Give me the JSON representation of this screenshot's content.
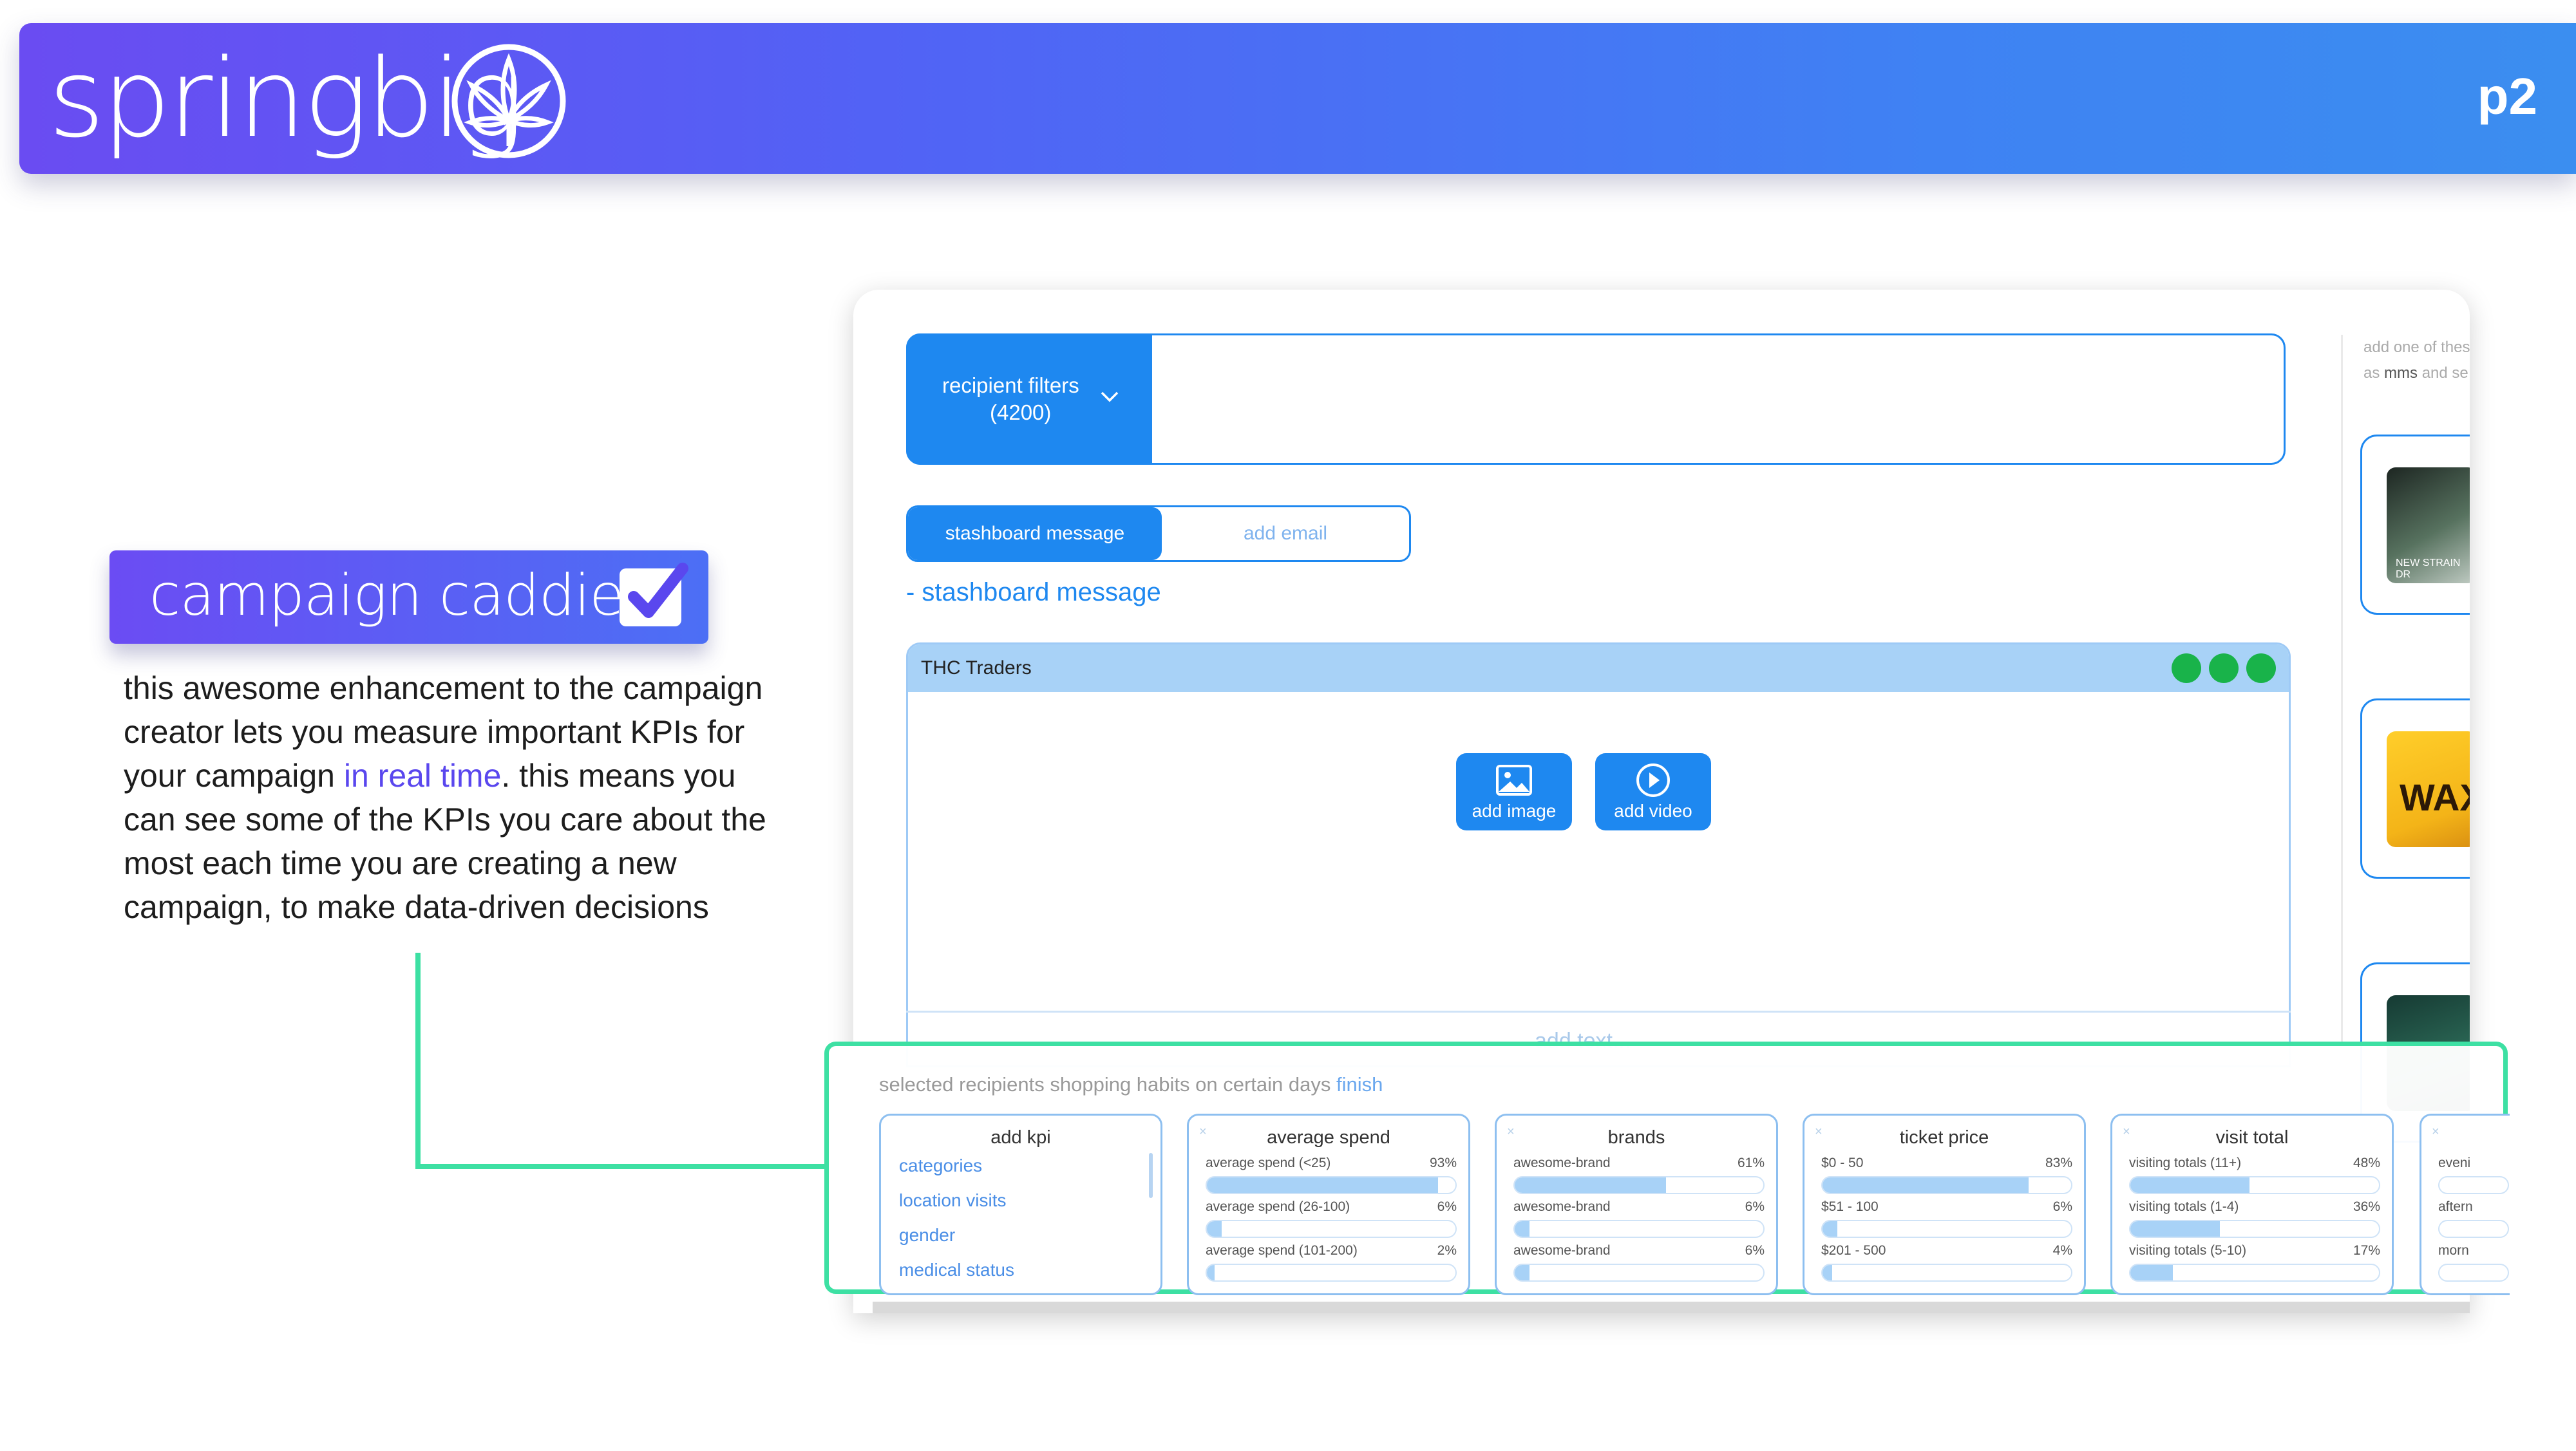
{
  "banner": {
    "brand": "springbig",
    "page": "p2"
  },
  "caddie": {
    "title": "campaign caddie",
    "desc_before": "this awesome enhancement to the campaign creator lets you measure important KPIs for your campaign ",
    "desc_highlight": "in real time",
    "desc_after": ". this means you can see some of the KPIs you care about the most each time you are creating a new campaign, to make data-driven decisions"
  },
  "app": {
    "filters": {
      "label": "recipient filters",
      "count": "(4200)"
    },
    "tabs": {
      "active": "stashboard message",
      "inactive": "add email"
    },
    "section_title": "- stashboard message",
    "message": {
      "sender": "THC Traders",
      "add_image": "add image",
      "add_video": "add video",
      "add_text": "add text..."
    },
    "side": {
      "note1": "add one of thes",
      "note2_a": "as",
      "note2_b": "mms",
      "note2_c": "and se",
      "tpl1_caption": "NEW STRAIN DR",
      "tpl2_caption": "WAX"
    },
    "kpi": {
      "header": "selected recipients shopping habits on certain days",
      "finish": "finish",
      "add_kpi_title": "add kpi",
      "add_kpi_items": [
        "categories",
        "location visits",
        "gender",
        "medical status"
      ],
      "cards": [
        {
          "title": "average spend",
          "rows": [
            {
              "label": "average spend (<25)",
              "pct": "93%",
              "value": 0.93
            },
            {
              "label": "average spend (26-100)",
              "pct": "6%",
              "value": 0.06
            },
            {
              "label": "average spend (101-200)",
              "pct": "2%",
              "value": 0.02
            }
          ]
        },
        {
          "title": "brands",
          "rows": [
            {
              "label": "awesome-brand",
              "pct": "61%",
              "value": 0.61
            },
            {
              "label": "awesome-brand",
              "pct": "6%",
              "value": 0.06
            },
            {
              "label": "awesome-brand",
              "pct": "6%",
              "value": 0.06
            }
          ]
        },
        {
          "title": "ticket price",
          "rows": [
            {
              "label": "$0 - 50",
              "pct": "83%",
              "value": 0.83
            },
            {
              "label": "$51 - 100",
              "pct": "6%",
              "value": 0.06
            },
            {
              "label": "$201 - 500",
              "pct": "4%",
              "value": 0.04
            }
          ]
        },
        {
          "title": "visit total",
          "rows": [
            {
              "label": "visiting totals (11+)",
              "pct": "48%",
              "value": 0.48
            },
            {
              "label": "visiting totals (1-4)",
              "pct": "36%",
              "value": 0.36
            },
            {
              "label": "visiting totals (5-10)",
              "pct": "17%",
              "value": 0.17
            }
          ]
        }
      ],
      "partial_card_rows": [
        "eveni",
        "aftern",
        "morn"
      ]
    }
  },
  "colors": {
    "accent": "#1e88f0",
    "kpi_frame": "#3de0a3",
    "brand_purple": "#6a4cf2"
  }
}
